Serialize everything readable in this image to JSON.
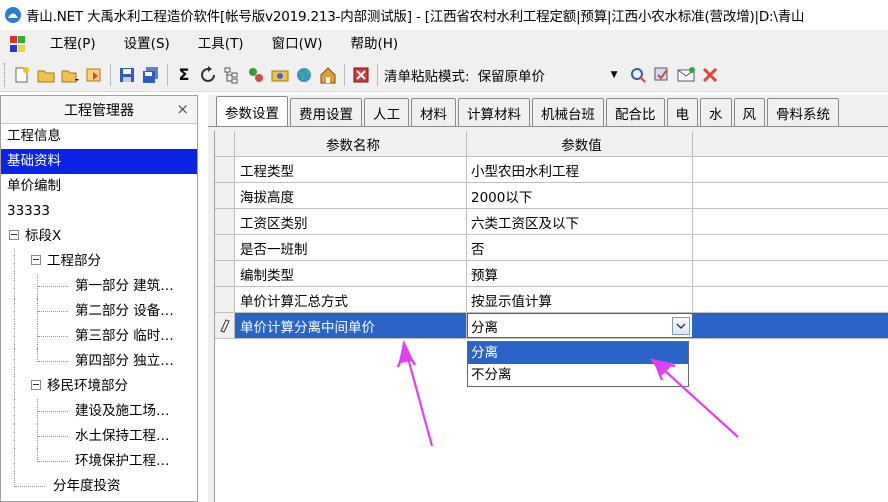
{
  "window": {
    "title": "青山.NET 大禹水利工程造价软件[帐号版v2019.213-内部测试版] - [江西省农村水利工程定额|预算|江西小农水标准(营改增)|D:\\青山"
  },
  "menu": [
    "工程(P)",
    "设置(S)",
    "工具(T)",
    "窗口(W)",
    "帮助(H)"
  ],
  "toolbar": {
    "icons": [
      "new-icon",
      "open-icon",
      "open-dropdown-icon",
      "import-icon",
      "save-icon",
      "save-all-icon",
      "sigma-icon",
      "refresh-icon",
      "tree-icon",
      "link-icon",
      "camera-icon",
      "globe-icon",
      "home-icon",
      "close-red-icon"
    ],
    "paste_mode_label": "清单粘贴模式:",
    "paste_mode_value": "保留原单价",
    "right_icons": [
      "calc-icon",
      "check-icon",
      "mail-icon",
      "tools-icon"
    ]
  },
  "left_panel": {
    "title": "工程管理器",
    "close": "×",
    "items": [
      {
        "label": "工程信息"
      },
      {
        "label": "基础资料",
        "selected": true
      },
      {
        "label": "单价编制"
      },
      {
        "label": "33333"
      },
      {
        "label": "标段X"
      },
      {
        "label": "工程部分"
      },
      {
        "label": "第一部分 建筑…"
      },
      {
        "label": "第二部分 设备…"
      },
      {
        "label": "第三部分 临时…"
      },
      {
        "label": "第四部分 独立…"
      },
      {
        "label": "移民环境部分"
      },
      {
        "label": "建设及施工场…"
      },
      {
        "label": "水土保持工程…"
      },
      {
        "label": "环境保护工程…"
      },
      {
        "label": "分年度投资"
      }
    ]
  },
  "tabs": [
    "参数设置",
    "费用设置",
    "人工",
    "材料",
    "计算材料",
    "机械台班",
    "配合比",
    "电",
    "水",
    "风",
    "骨料系统"
  ],
  "grid": {
    "headers": {
      "name": "参数名称",
      "value": "参数值"
    },
    "rows": [
      {
        "name": "工程类型",
        "value": "小型农田水利工程"
      },
      {
        "name": "海拔高度",
        "value": "2000以下"
      },
      {
        "name": "工资区类别",
        "value": "六类工资区及以下"
      },
      {
        "name": "是否一班制",
        "value": "否"
      },
      {
        "name": "编制类型",
        "value": "预算"
      },
      {
        "name": "单价计算汇总方式",
        "value": "按显示值计算"
      },
      {
        "name": "单价计算分离中间单价",
        "value": "分离",
        "editing": true
      }
    ],
    "dropdown_options": [
      {
        "label": "分离",
        "selected": true
      },
      {
        "label": "不分离"
      }
    ]
  },
  "colors": {
    "selection_blue": "#2a64c8",
    "tree_selection": "#0a24e6",
    "arrow_magenta": "#e040f0"
  }
}
